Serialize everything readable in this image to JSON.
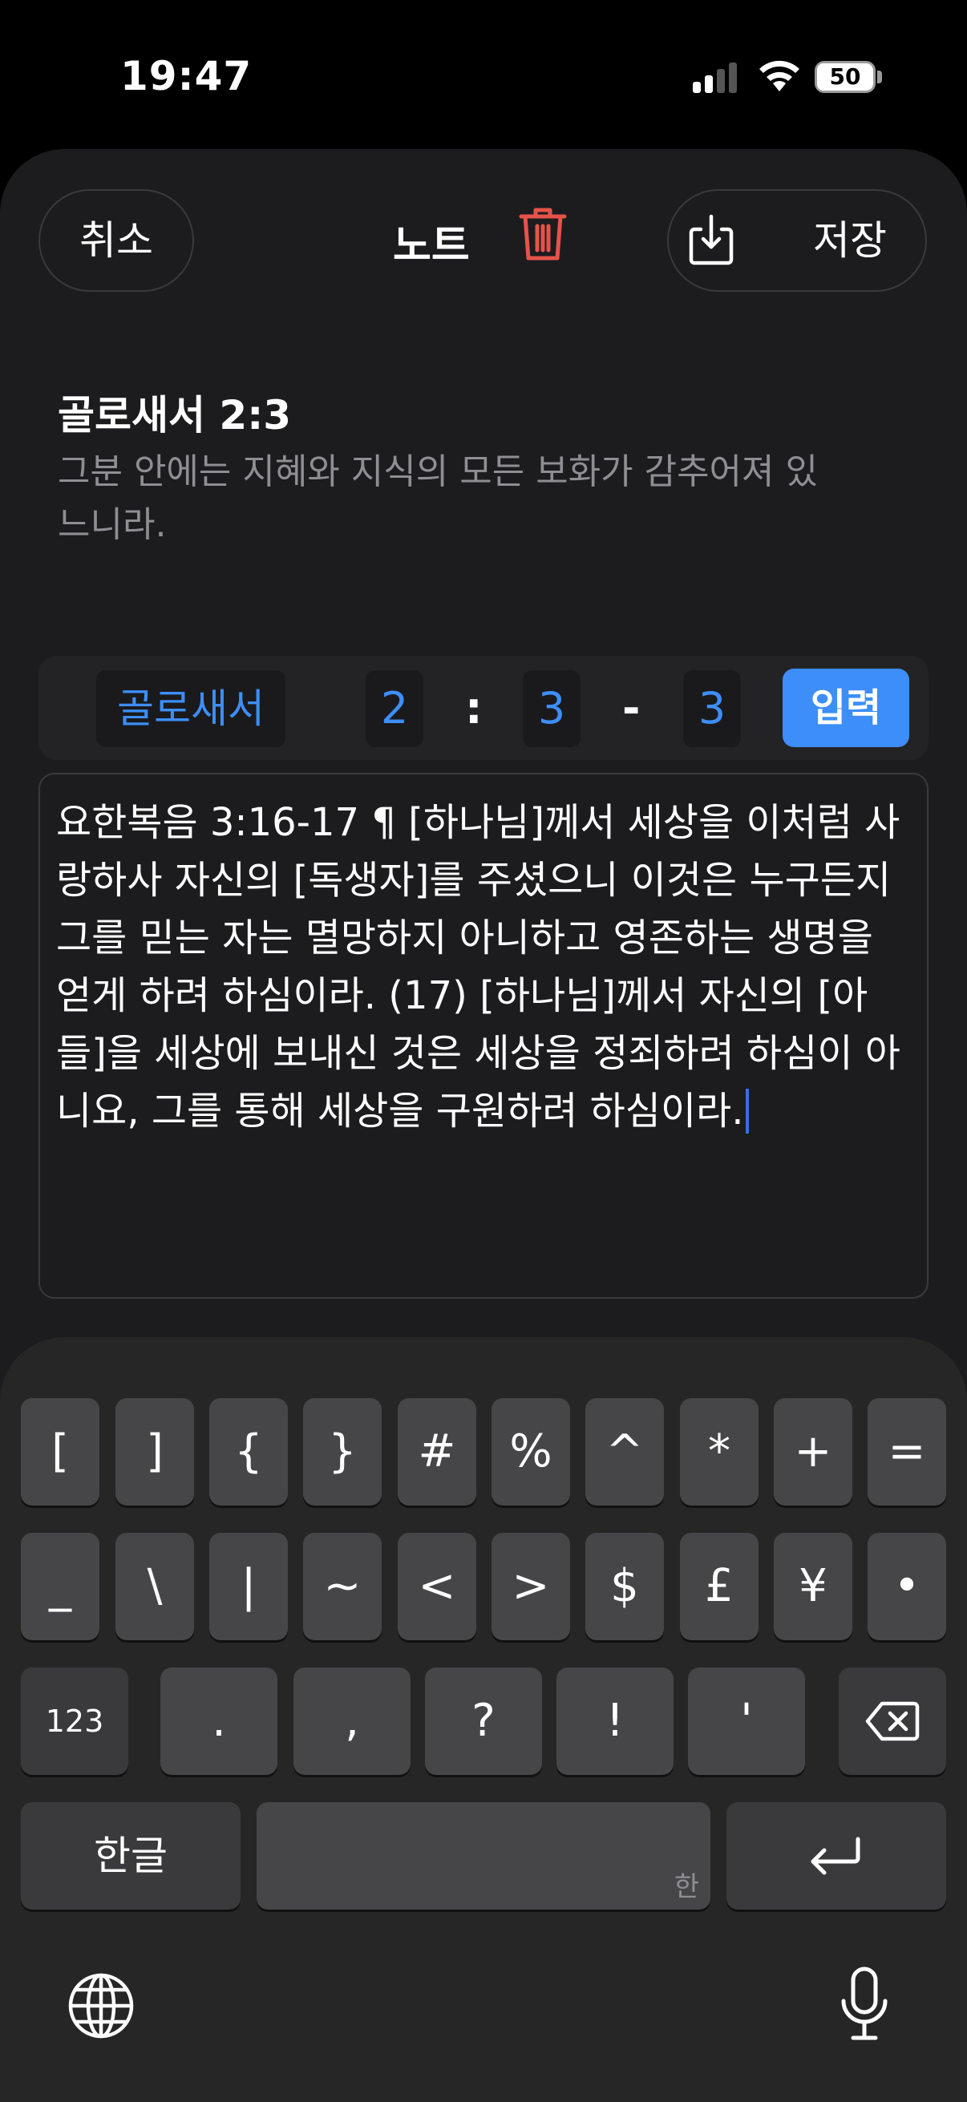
{
  "status_bar": {
    "time": "19:47",
    "battery": "50",
    "battery_level": 0.5
  },
  "header": {
    "cancel_label": "취소",
    "title": "노트",
    "save_label": "저장",
    "trash_icon": "trash-icon",
    "download_icon": "download-icon",
    "accent_red": "#e5534b"
  },
  "passage": {
    "reference": "골로새서 2:3",
    "text": "그분 안에는 지혜와 지식의 모든 보화가 감추어져 있느니라."
  },
  "reference_input": {
    "book": "골로새서",
    "chapter": "2",
    "colon": ":",
    "verse_start": "3",
    "dash": "-",
    "verse_end": "3",
    "enter_label": "입력",
    "accent": "#3d8ef8"
  },
  "editor": {
    "content": "요한복음 3:16-17 ¶ [하나님]께서 세상을 이처럼 사랑하사 자신의 [독생자]를 주셨으니 이것은 누구든지 그를 믿는 자는 멸망하지 아니하고 영존하는 생명을 얻게 하려 하심이라. (17) [하나님]께서 자신의 [아들]을 세상에 보내신 것은 세상을 정죄하려 하심이 아니요, 그를 통해 세상을 구원하려 하심이라."
  },
  "keyboard": {
    "row1": [
      "[",
      "]",
      "{",
      "}",
      "#",
      "%",
      "^",
      "*",
      "+",
      "="
    ],
    "row2": [
      "_",
      "\\",
      "|",
      "~",
      "<",
      ">",
      "$",
      "£",
      "¥",
      "•"
    ],
    "row3": [
      "123",
      ".",
      ",",
      "?",
      "!",
      "'"
    ],
    "row4": {
      "lang": "한글",
      "space_hint": "한"
    },
    "icons": [
      "backspace-icon",
      "return-icon",
      "globe-icon",
      "microphone-icon"
    ]
  }
}
